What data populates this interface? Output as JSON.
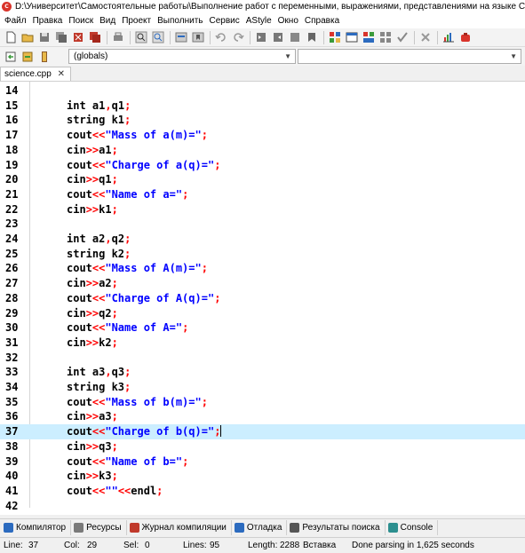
{
  "window": {
    "title": "D:\\Университет\\Самостоятельные работы\\Выполнение работ с переменными, выражениями, представлениями на языке С++\\science.cpp - En"
  },
  "menu": [
    "Файл",
    "Правка",
    "Поиск",
    "Вид",
    "Проект",
    "Выполнить",
    "Сервис",
    "AStyle",
    "Окно",
    "Справка"
  ],
  "toolbar2": {
    "scope_value": "(globals)"
  },
  "tab": {
    "label": "science.cpp",
    "close": "✕"
  },
  "editor": {
    "active_line": 37,
    "lines": [
      {
        "n": "14",
        "parts": []
      },
      {
        "n": "15",
        "parts": [
          [
            "kw",
            "int"
          ],
          [
            "t",
            " a1"
          ],
          [
            "op",
            ","
          ],
          [
            "t",
            "q1"
          ],
          [
            "op",
            ";"
          ]
        ]
      },
      {
        "n": "16",
        "parts": [
          [
            "t",
            "string k1"
          ],
          [
            "op",
            ";"
          ]
        ]
      },
      {
        "n": "17",
        "parts": [
          [
            "t",
            "cout"
          ],
          [
            "op",
            "<<"
          ],
          [
            "str",
            "\"Mass of a(m)=\""
          ],
          [
            "op",
            ";"
          ]
        ]
      },
      {
        "n": "18",
        "parts": [
          [
            "t",
            "cin"
          ],
          [
            "op",
            ">>"
          ],
          [
            "t",
            "a1"
          ],
          [
            "op",
            ";"
          ]
        ]
      },
      {
        "n": "19",
        "parts": [
          [
            "t",
            "cout"
          ],
          [
            "op",
            "<<"
          ],
          [
            "str",
            "\"Charge of a(q)=\""
          ],
          [
            "op",
            ";"
          ]
        ]
      },
      {
        "n": "20",
        "parts": [
          [
            "t",
            "cin"
          ],
          [
            "op",
            ">>"
          ],
          [
            "t",
            "q1"
          ],
          [
            "op",
            ";"
          ]
        ]
      },
      {
        "n": "21",
        "parts": [
          [
            "t",
            "cout"
          ],
          [
            "op",
            "<<"
          ],
          [
            "str",
            "\"Name of a=\""
          ],
          [
            "op",
            ";"
          ]
        ]
      },
      {
        "n": "22",
        "parts": [
          [
            "t",
            "cin"
          ],
          [
            "op",
            ">>"
          ],
          [
            "t",
            "k1"
          ],
          [
            "op",
            ";"
          ]
        ]
      },
      {
        "n": "23",
        "parts": []
      },
      {
        "n": "24",
        "parts": [
          [
            "kw",
            "int"
          ],
          [
            "t",
            " a2"
          ],
          [
            "op",
            ","
          ],
          [
            "t",
            "q2"
          ],
          [
            "op",
            ";"
          ]
        ]
      },
      {
        "n": "25",
        "parts": [
          [
            "t",
            "string k2"
          ],
          [
            "op",
            ";"
          ]
        ]
      },
      {
        "n": "26",
        "parts": [
          [
            "t",
            "cout"
          ],
          [
            "op",
            "<<"
          ],
          [
            "str",
            "\"Mass of A(m)=\""
          ],
          [
            "op",
            ";"
          ]
        ]
      },
      {
        "n": "27",
        "parts": [
          [
            "t",
            "cin"
          ],
          [
            "op",
            ">>"
          ],
          [
            "t",
            "a2"
          ],
          [
            "op",
            ";"
          ]
        ]
      },
      {
        "n": "28",
        "parts": [
          [
            "t",
            "cout"
          ],
          [
            "op",
            "<<"
          ],
          [
            "str",
            "\"Charge of A(q)=\""
          ],
          [
            "op",
            ";"
          ]
        ]
      },
      {
        "n": "29",
        "parts": [
          [
            "t",
            "cin"
          ],
          [
            "op",
            ">>"
          ],
          [
            "t",
            "q2"
          ],
          [
            "op",
            ";"
          ]
        ]
      },
      {
        "n": "30",
        "parts": [
          [
            "t",
            "cout"
          ],
          [
            "op",
            "<<"
          ],
          [
            "str",
            "\"Name of A=\""
          ],
          [
            "op",
            ";"
          ]
        ]
      },
      {
        "n": "31",
        "parts": [
          [
            "t",
            "cin"
          ],
          [
            "op",
            ">>"
          ],
          [
            "t",
            "k2"
          ],
          [
            "op",
            ";"
          ]
        ]
      },
      {
        "n": "32",
        "parts": []
      },
      {
        "n": "33",
        "parts": [
          [
            "kw",
            "int"
          ],
          [
            "t",
            " a3"
          ],
          [
            "op",
            ","
          ],
          [
            "t",
            "q3"
          ],
          [
            "op",
            ";"
          ]
        ]
      },
      {
        "n": "34",
        "parts": [
          [
            "t",
            "string k3"
          ],
          [
            "op",
            ";"
          ]
        ]
      },
      {
        "n": "35",
        "parts": [
          [
            "t",
            "cout"
          ],
          [
            "op",
            "<<"
          ],
          [
            "str",
            "\"Mass of b(m)=\""
          ],
          [
            "op",
            ";"
          ]
        ]
      },
      {
        "n": "36",
        "parts": [
          [
            "t",
            "cin"
          ],
          [
            "op",
            ">>"
          ],
          [
            "t",
            "a3"
          ],
          [
            "op",
            ";"
          ]
        ]
      },
      {
        "n": "37",
        "parts": [
          [
            "t",
            "cout"
          ],
          [
            "op",
            "<<"
          ],
          [
            "str",
            "\"Charge of b(q)=\""
          ],
          [
            "op",
            ";"
          ]
        ]
      },
      {
        "n": "38",
        "parts": [
          [
            "t",
            "cin"
          ],
          [
            "op",
            ">>"
          ],
          [
            "t",
            "q3"
          ],
          [
            "op",
            ";"
          ]
        ]
      },
      {
        "n": "39",
        "parts": [
          [
            "t",
            "cout"
          ],
          [
            "op",
            "<<"
          ],
          [
            "str",
            "\"Name of b=\""
          ],
          [
            "op",
            ";"
          ]
        ]
      },
      {
        "n": "40",
        "parts": [
          [
            "t",
            "cin"
          ],
          [
            "op",
            ">>"
          ],
          [
            "t",
            "k3"
          ],
          [
            "op",
            ";"
          ]
        ]
      },
      {
        "n": "41",
        "parts": [
          [
            "t",
            "cout"
          ],
          [
            "op",
            "<<"
          ],
          [
            "str",
            "\"\""
          ],
          [
            "op",
            "<<"
          ],
          [
            "t",
            "endl"
          ],
          [
            "op",
            ";"
          ]
        ]
      },
      {
        "n": "42",
        "parts": []
      }
    ]
  },
  "bottom_tabs": [
    {
      "name": "compiler",
      "label": "Компилятор",
      "icon": "compiler-icon",
      "color": "#2c6bbf"
    },
    {
      "name": "resources",
      "label": "Ресурсы",
      "icon": "resources-icon",
      "color": "#7a7a7a"
    },
    {
      "name": "compile-log",
      "label": "Журнал компиляции",
      "icon": "compile-log-icon",
      "color": "#c0392b"
    },
    {
      "name": "debug",
      "label": "Отладка",
      "icon": "debug-icon",
      "color": "#2c6bbf"
    },
    {
      "name": "search-results",
      "label": "Результаты поиска",
      "icon": "search-results-icon",
      "color": "#555555"
    },
    {
      "name": "console",
      "label": "Console",
      "icon": "console-icon",
      "color": "#2c8f8f"
    }
  ],
  "status": {
    "line_label": "Line:",
    "line_value": "37",
    "col_label": "Col:",
    "col_value": "29",
    "sel_label": "Sel:",
    "sel_value": "0",
    "lines_label": "Lines:",
    "lines_value": "95",
    "length_label": "Length:",
    "length_value": "2288",
    "mode": "Вставка",
    "message": "Done parsing in 1,625 seconds"
  },
  "colors": {
    "keyword": "#000000",
    "operator": "#ff0000",
    "string": "#0000ff",
    "active_line": "#cceeff"
  }
}
